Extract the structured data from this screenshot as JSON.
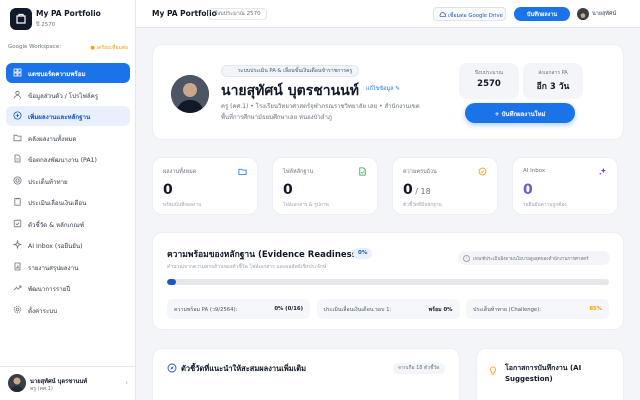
{
  "sidebar": {
    "brand_title": "My PA Portfolio",
    "brand_sub": "ปี 2570",
    "workspace_label": "Google Workspace:",
    "workspace_status": "● เตรียมเชื่อมต่อ",
    "items": [
      {
        "label": "แดชบอร์ดความพร้อม",
        "icon": "grid-icon"
      },
      {
        "label": "ข้อมูลส่วนตัว / โปรไฟล์ครู",
        "icon": "user-icon"
      },
      {
        "label": "เพิ่มผลงานและหลักฐาน",
        "icon": "plus-circle-icon"
      },
      {
        "label": "คลังผลงานทั้งหมด",
        "icon": "folder-icon"
      },
      {
        "label": "ข้อตกลงพัฒนางาน (PA1)",
        "icon": "document-icon"
      },
      {
        "label": "ประเด็นท้าทาย",
        "icon": "target-icon"
      },
      {
        "label": "ประเมินเลื่อนเงินเดือน",
        "icon": "clipboard-icon"
      },
      {
        "label": "ตัวชี้วัด & หลักเกณฑ์",
        "icon": "check-square-icon"
      },
      {
        "label": "AI Inbox (รอยืนยัน)",
        "icon": "sparkle-icon"
      },
      {
        "label": "รายงานสรุปผลงาน",
        "icon": "report-icon"
      },
      {
        "label": "พัฒนาการรายปี",
        "icon": "trend-icon"
      },
      {
        "label": "ตั้งค่าระบบ",
        "icon": "gear-icon"
      }
    ],
    "user_name": "นายสุทัศน์ บุตรชานนท์",
    "user_role": "ครู (คศ.1)"
  },
  "topbar": {
    "title": "My PA Portfolio",
    "year": "ปีงบประมาณ 2570",
    "drive_button": "เชื่อมต่อ Google Drive",
    "save_button": "บันทึกผลงาน",
    "user_name": "นายสุทัศน์"
  },
  "profile": {
    "badge": "ระบบประเมิน PA & เลื่อนขั้นเงินเดือนข้าราชการครู",
    "name": "นายสุทัศน์ บุตรชานนท์",
    "edit_link": "แก้ไขข้อมูล ✎",
    "desc_line1": "ครู (คศ.1) • โรงเรียนวิทยาศาสตร์จุฬาภรณราชวิทยาลัย เลย • สำนักงานเขต",
    "desc_line2": "พื้นที่การศึกษามัธยมศึกษาเลย หนองบัวลำภู",
    "stat_year_label": "ปีงบประมาณ",
    "stat_year_value": "2570",
    "stat_due_label": "ส่งเอกสาร PA",
    "stat_due_value": "อีก 3 วัน",
    "record_button": "+ บันทึกผลงานใหม่"
  },
  "stats": [
    {
      "label": "ผลงานทั้งหมด",
      "value": "0",
      "suffix": "",
      "sub": "พร้อมบันทึกผลงาน",
      "icon": "folder-icon",
      "color": "#1a73e8"
    },
    {
      "label": "ไฟล์หลักฐาน",
      "value": "0",
      "suffix": "",
      "sub": "ไฟล์เอกสาร & รูปภาพ",
      "icon": "file-icon",
      "color": "#16a34a"
    },
    {
      "label": "ความครบถ้วน",
      "value": "0",
      "suffix": " / 18",
      "sub": "ตัวชี้วัดที่มีหลักฐาน",
      "icon": "check-circle-icon",
      "color": "#f59e0b"
    },
    {
      "label": "AI Inbox",
      "value": "0",
      "suffix": "",
      "sub": "รอยืนยันความถูกต้อง",
      "icon": "sparkle-icon",
      "color": "#7c3aed"
    }
  ],
  "readiness": {
    "title": "ความพร้อมของหลักฐาน (Evidence Readiness)",
    "percent_badge": "0%",
    "subtitle": "คำนวณจากความครบถ้วนของตัวชี้วัด ไฟล์เอกสาร และผลลัพธ์เชิงประจักษ์",
    "note": "เกณฑ์ประเมินอิงตามนโยบายสูงสุดของสำนักงานการศาสตร์",
    "progress": 0.02,
    "items": [
      {
        "label": "ความพร้อม PA (ว9/2564):",
        "value": "0% (0/16)",
        "color": "#111827"
      },
      {
        "label": "ประเมินเลื่อนเงินเดือน รอบ 1:",
        "value": "พร้อม 0%",
        "color": "#111827"
      },
      {
        "label": "ประเด็นท้าทาย (Challenge):",
        "value": "85%",
        "color": "#f59e0b"
      }
    ]
  },
  "suggest": {
    "title": "ตัวชี้วัดที่แนะนำให้สะสมผลงานเพิ่มเติม",
    "chip": "จากเกือ 18 ตัวชี้วัด"
  },
  "ai_suggest": {
    "title": "โอกาสการบันทึกงาน (AI Suggestion)"
  }
}
